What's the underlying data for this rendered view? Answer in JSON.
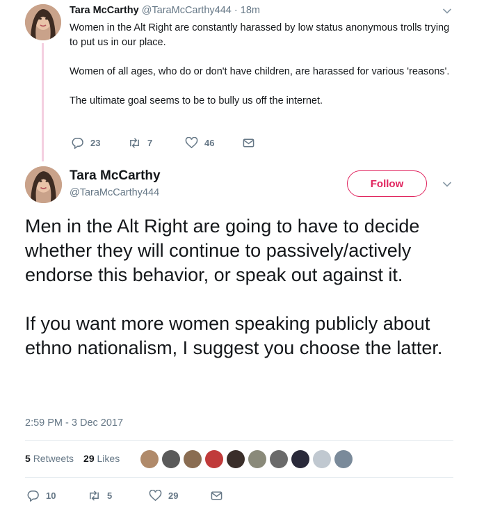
{
  "reply_tweet": {
    "author_name": "Tara McCarthy",
    "handle": "@TaraMcCarthy444",
    "time": "18m",
    "separator": "·",
    "paragraphs": [
      "Women in the Alt Right are constantly harassed by low status anonymous trolls trying to put us in our place.",
      "Women of all ages, who do or don't have children, are harassed for various 'reasons'.",
      "The ultimate goal seems to be to bully us off the internet."
    ],
    "actions": {
      "replies": "23",
      "retweets": "7",
      "likes": "46"
    }
  },
  "main_tweet": {
    "author_name": "Tara McCarthy",
    "handle": "@TaraMcCarthy444",
    "follow_label": "Follow",
    "paragraphs": [
      "Men in the Alt Right are going to have to decide whether they will continue to passively/actively endorse this behavior, or speak out against it.",
      "If you want more women speaking publicly about ethno nationalism, I suggest you choose the latter."
    ],
    "timestamp": "2:59 PM - 3 Dec 2017",
    "stats": {
      "retweets_count": "5",
      "retweets_label": "Retweets",
      "likes_count": "29",
      "likes_label": "Likes"
    },
    "liker_colors": [
      "#b08a6a",
      "#5a5a5a",
      "#8a6d52",
      "#c03a3a",
      "#3a2e2a",
      "#8a8a7a",
      "#6a6a6a",
      "#2a2a3a",
      "#c0c8d0",
      "#7a8a9a"
    ],
    "actions": {
      "replies": "10",
      "retweets": "5",
      "likes": "29"
    }
  },
  "icons": [
    "reply-icon",
    "retweet-icon",
    "heart-icon",
    "envelope-icon",
    "chevron-down-icon"
  ],
  "colors": {
    "accent": "#e0245e",
    "muted": "#657786",
    "thread_line": "#f4cfe0"
  }
}
